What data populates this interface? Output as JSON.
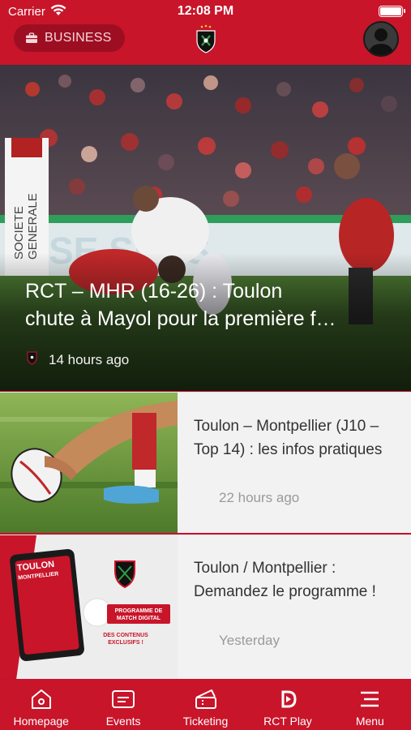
{
  "status_bar": {
    "carrier": "Carrier",
    "time": "12:08 PM"
  },
  "header": {
    "business_label": "BUSINESS",
    "logo_icon": "rct-shield-logo",
    "avatar_icon": "user-avatar-icon"
  },
  "hero": {
    "title_line1": "RCT – MHR (16-26) : Toulon",
    "title_line2": "chute à Mayol pour la première f…",
    "time": "14 hours ago"
  },
  "news": [
    {
      "title": "Toulon – Montpellier (J10 – Top 14) : les infos pratiques",
      "time": "22 hours ago"
    },
    {
      "title": "Toulon / Montpellier : Demandez le programme !",
      "time": "Yesterday"
    }
  ],
  "news_thumb2": {
    "poster_title": "TOULON",
    "poster_sub": "MONTPELLIER",
    "badge_line1": "PROGRAMME DE",
    "badge_line2": "MATCH DIGITAL",
    "caption_line1": "DES CONTENUS",
    "caption_line2": "EXCLUSIFS !"
  },
  "hero_banner_text": {
    "sponsor_vertical_1": "SOCIETE",
    "sponsor_vertical_2": "GENERALE",
    "ad_text": "SE SENS"
  },
  "tabs": [
    {
      "label": "Homepage",
      "icon": "home-icon"
    },
    {
      "label": "Events",
      "icon": "events-icon"
    },
    {
      "label": "Ticketing",
      "icon": "ticket-icon"
    },
    {
      "label": "RCT Play",
      "icon": "play-icon"
    },
    {
      "label": "Menu",
      "icon": "menu-icon"
    }
  ],
  "colors": {
    "brand_red": "#c8152a",
    "dark_red": "#9e0e22",
    "list_bg": "#f2f2f2"
  }
}
